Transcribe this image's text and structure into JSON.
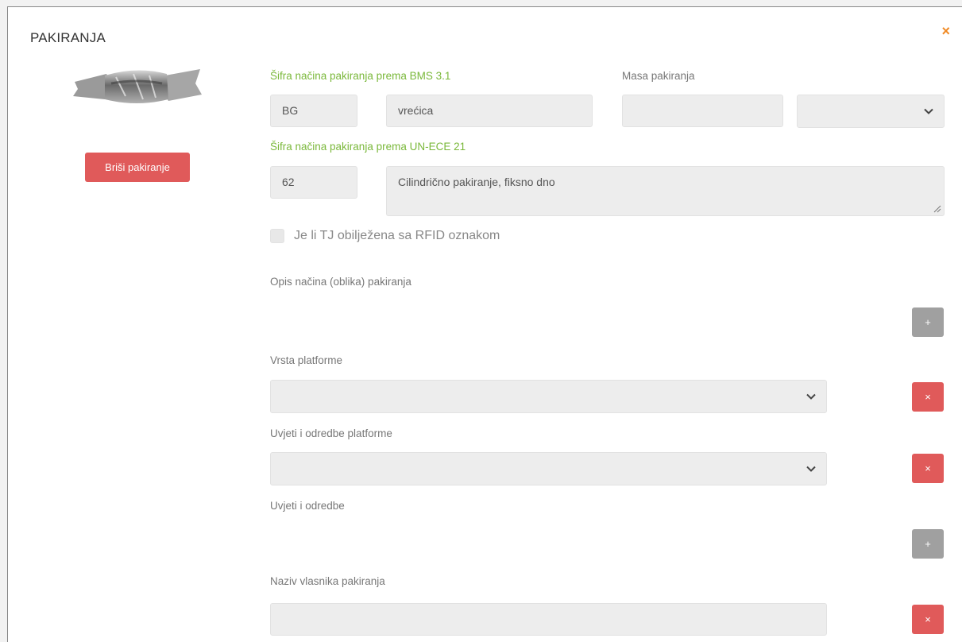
{
  "panel": {
    "title": "PAKIRANJA",
    "close_glyph": "×",
    "image_icon": "candy-wrapper-package-icon",
    "delete_packaging_label": "Briši pakiranje"
  },
  "bms": {
    "label": "Šifra načina pakiranja prema BMS 3.1",
    "code": "BG",
    "name": "vrećica"
  },
  "mass": {
    "label": "Masa pakiranja",
    "value": "",
    "unit_selected": ""
  },
  "unece": {
    "label": "Šifra načina pakiranja prema UN-ECE 21",
    "code": "62",
    "description": "Cilindrično pakiranje, fiksno dno"
  },
  "rfid": {
    "label": "Je li TJ obilježena sa RFID oznakom",
    "checked": false
  },
  "packaging_description": {
    "label": "Opis načina (oblika) pakiranja",
    "add_glyph": "+"
  },
  "platform_type": {
    "label": "Vrsta platforme",
    "selected": "",
    "remove_glyph": "×"
  },
  "platform_terms": {
    "label": "Uvjeti i odredbe platforme",
    "selected": "",
    "remove_glyph": "×"
  },
  "terms": {
    "label": "Uvjeti i odredbe",
    "add_glyph": "+"
  },
  "owner": {
    "label": "Naziv vlasnika pakiranja",
    "value": "",
    "remove_glyph": "×"
  },
  "colors": {
    "accent_green": "#7ab83a",
    "danger_red": "#e05a5a",
    "close_orange": "#f08a24",
    "neutral_gray": "#a0a0a0"
  }
}
